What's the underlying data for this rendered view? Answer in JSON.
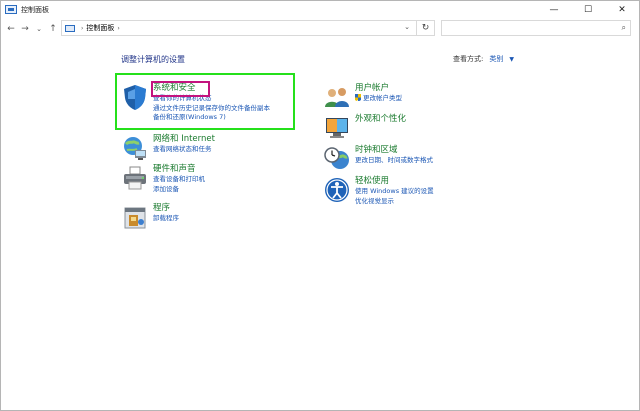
{
  "window": {
    "title": "控制面板",
    "minimize_glyph": "—",
    "maximize_glyph": "☐",
    "close_glyph": "✕"
  },
  "nav": {
    "back": "←",
    "forward": "→",
    "recent": "⌄",
    "up": "↑",
    "breadcrumb": "控制面板",
    "breadcrumb_sep": "›",
    "dropdown": "⌄",
    "refresh": "↻",
    "search_icon": "⌕"
  },
  "main": {
    "heading": "调整计算机的设置",
    "view_by_label": "查看方式:",
    "view_by_value": "类别",
    "view_by_caret": "▼"
  },
  "left_categories": [
    {
      "title": "系统和安全",
      "icon": "shield-icon",
      "links": [
        "查看你的计算机状态",
        "通过文件历史记录保存你的文件备份副本",
        "备份和还原(Windows 7)"
      ]
    },
    {
      "title": "网络和 Internet",
      "icon": "network-icon",
      "links": [
        "查看网络状态和任务"
      ]
    },
    {
      "title": "硬件和声音",
      "icon": "printer-icon",
      "links": [
        "查看设备和打印机",
        "添加设备"
      ]
    },
    {
      "title": "程序",
      "icon": "programs-icon",
      "links": [
        "卸载程序"
      ]
    }
  ],
  "right_categories": [
    {
      "title": "用户帐户",
      "icon": "users-icon",
      "links": [
        "更改帐户类型"
      ]
    },
    {
      "title": "外观和个性化",
      "icon": "appearance-icon",
      "links": []
    },
    {
      "title": "时钟和区域",
      "icon": "clock-globe-icon",
      "links": [
        "更改日期、时间或数字格式"
      ]
    },
    {
      "title": "轻松使用",
      "icon": "ease-of-access-icon",
      "links": [
        "使用 Windows 建议的设置",
        "优化视觉显示"
      ]
    }
  ],
  "colors": {
    "category_title": "#1a7a2e",
    "link": "#1a56b4",
    "heading": "#1e3287",
    "highlight_green": "#25e01b",
    "highlight_pink": "#c3137e"
  }
}
